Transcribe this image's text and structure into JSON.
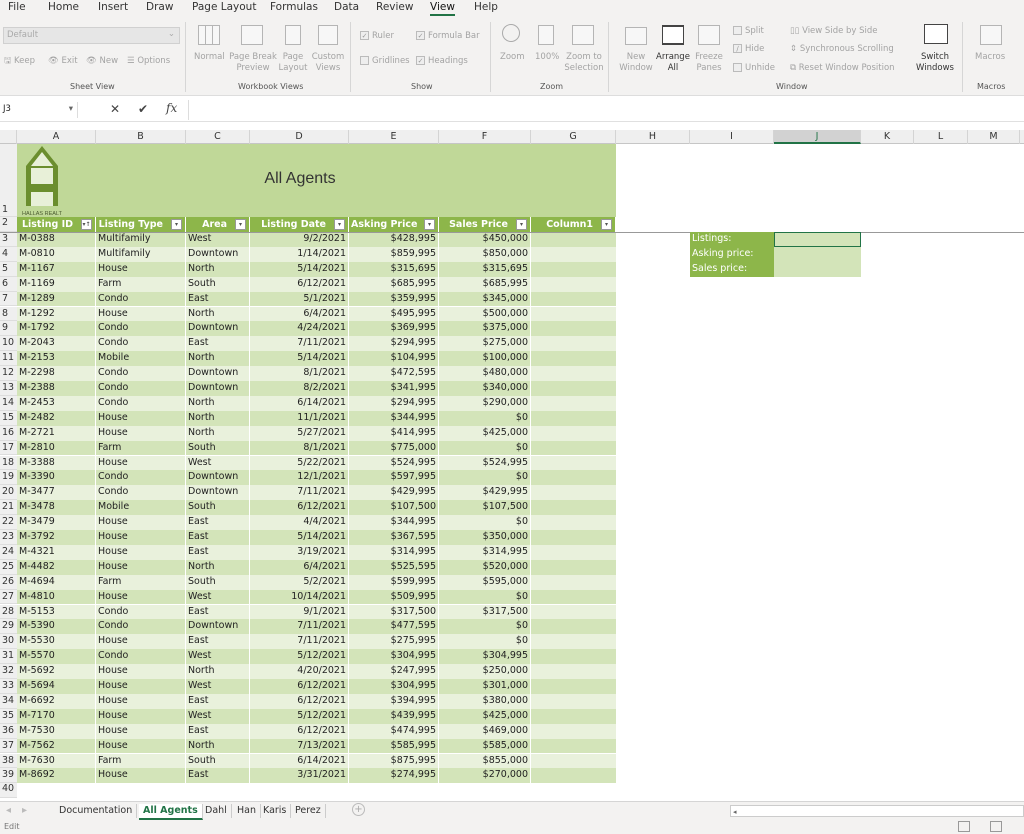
{
  "menu": [
    "File",
    "Home",
    "Insert",
    "Draw",
    "Page Layout",
    "Formulas",
    "Data",
    "Review",
    "View",
    "Help"
  ],
  "ribbon": {
    "sheet_view": {
      "dropdown": "Default",
      "keep": "Keep",
      "exit": "Exit",
      "new": "New",
      "options": "Options",
      "label": "Sheet View"
    },
    "workbook_views": {
      "normal": "Normal",
      "page_break": "Page Break Preview",
      "page_layout": "Page Layout",
      "custom": "Custom Views",
      "label": "Workbook Views"
    },
    "show": {
      "ruler": "Ruler",
      "formula_bar": "Formula Bar",
      "gridlines": "Gridlines",
      "headings": "Headings",
      "label": "Show",
      "ruler_checked": true,
      "formula_bar_checked": true,
      "gridlines_checked": false,
      "headings_checked": true
    },
    "zoom": {
      "zoom": "Zoom",
      "hundred": "100%",
      "zoom_sel": "Zoom to Selection",
      "label": "Zoom"
    },
    "window": {
      "new_window": "New Window",
      "arrange_all": "Arrange All",
      "freeze": "Freeze Panes",
      "split": "Split",
      "hide": "Hide",
      "unhide": "Unhide",
      "side_by_side": "View Side by Side",
      "sync": "Synchronous Scrolling",
      "reset": "Reset Window Position",
      "switch": "Switch Windows",
      "label": "Window"
    },
    "macros": {
      "macros": "Macros",
      "label": "Macros"
    }
  },
  "formula_bar": {
    "name_box": "J3",
    "value": ""
  },
  "columns": [
    "A",
    "B",
    "C",
    "D",
    "E",
    "F",
    "G",
    "H",
    "I",
    "J",
    "K",
    "L",
    "M"
  ],
  "sheet": {
    "title": "All Agents",
    "logo_text": "HALLAS REALTY",
    "headers": [
      "Listing ID",
      "Listing Type",
      "Area",
      "Listing Date",
      "Asking Price",
      "Sales Price",
      "Column1"
    ],
    "rows": [
      [
        "M-0388",
        "Multifamily",
        "West",
        "9/2/2021",
        "$428,995",
        "$450,000"
      ],
      [
        "M-0810",
        "Multifamily",
        "Downtown",
        "1/14/2021",
        "$859,995",
        "$850,000"
      ],
      [
        "M-1167",
        "House",
        "North",
        "5/14/2021",
        "$315,695",
        "$315,695"
      ],
      [
        "M-1169",
        "Farm",
        "South",
        "6/12/2021",
        "$685,995",
        "$685,995"
      ],
      [
        "M-1289",
        "Condo",
        "East",
        "5/1/2021",
        "$359,995",
        "$345,000"
      ],
      [
        "M-1292",
        "House",
        "North",
        "6/4/2021",
        "$495,995",
        "$500,000"
      ],
      [
        "M-1792",
        "Condo",
        "Downtown",
        "4/24/2021",
        "$369,995",
        "$375,000"
      ],
      [
        "M-2043",
        "Condo",
        "East",
        "7/11/2021",
        "$294,995",
        "$275,000"
      ],
      [
        "M-2153",
        "Mobile",
        "North",
        "5/14/2021",
        "$104,995",
        "$100,000"
      ],
      [
        "M-2298",
        "Condo",
        "Downtown",
        "8/1/2021",
        "$472,595",
        "$480,000"
      ],
      [
        "M-2388",
        "Condo",
        "Downtown",
        "8/2/2021",
        "$341,995",
        "$340,000"
      ],
      [
        "M-2453",
        "Condo",
        "North",
        "6/14/2021",
        "$294,995",
        "$290,000"
      ],
      [
        "M-2482",
        "House",
        "North",
        "11/1/2021",
        "$344,995",
        "$0"
      ],
      [
        "M-2721",
        "House",
        "North",
        "5/27/2021",
        "$414,995",
        "$425,000"
      ],
      [
        "M-2810",
        "Farm",
        "South",
        "8/1/2021",
        "$775,000",
        "$0"
      ],
      [
        "M-3388",
        "House",
        "West",
        "5/22/2021",
        "$524,995",
        "$524,995"
      ],
      [
        "M-3390",
        "Condo",
        "Downtown",
        "12/1/2021",
        "$597,995",
        "$0"
      ],
      [
        "M-3477",
        "Condo",
        "Downtown",
        "7/11/2021",
        "$429,995",
        "$429,995"
      ],
      [
        "M-3478",
        "Mobile",
        "South",
        "6/12/2021",
        "$107,500",
        "$107,500"
      ],
      [
        "M-3479",
        "House",
        "East",
        "4/4/2021",
        "$344,995",
        "$0"
      ],
      [
        "M-3792",
        "House",
        "East",
        "5/14/2021",
        "$367,595",
        "$350,000"
      ],
      [
        "M-4321",
        "House",
        "East",
        "3/19/2021",
        "$314,995",
        "$314,995"
      ],
      [
        "M-4482",
        "House",
        "North",
        "6/4/2021",
        "$525,595",
        "$520,000"
      ],
      [
        "M-4694",
        "Farm",
        "South",
        "5/2/2021",
        "$599,995",
        "$595,000"
      ],
      [
        "M-4810",
        "House",
        "West",
        "10/14/2021",
        "$509,995",
        "$0"
      ],
      [
        "M-5153",
        "Condo",
        "East",
        "9/1/2021",
        "$317,500",
        "$317,500"
      ],
      [
        "M-5390",
        "Condo",
        "Downtown",
        "7/11/2021",
        "$477,595",
        "$0"
      ],
      [
        "M-5530",
        "House",
        "East",
        "7/11/2021",
        "$275,995",
        "$0"
      ],
      [
        "M-5570",
        "Condo",
        "West",
        "5/12/2021",
        "$304,995",
        "$304,995"
      ],
      [
        "M-5692",
        "House",
        "North",
        "4/20/2021",
        "$247,995",
        "$250,000"
      ],
      [
        "M-5694",
        "House",
        "West",
        "6/12/2021",
        "$304,995",
        "$301,000"
      ],
      [
        "M-6692",
        "House",
        "East",
        "6/12/2021",
        "$394,995",
        "$380,000"
      ],
      [
        "M-7170",
        "House",
        "West",
        "5/12/2021",
        "$439,995",
        "$425,000"
      ],
      [
        "M-7530",
        "House",
        "East",
        "6/12/2021",
        "$474,995",
        "$469,000"
      ],
      [
        "M-7562",
        "House",
        "North",
        "7/13/2021",
        "$585,995",
        "$585,000"
      ],
      [
        "M-7630",
        "Farm",
        "South",
        "6/14/2021",
        "$875,995",
        "$855,000"
      ],
      [
        "M-8692",
        "House",
        "East",
        "3/31/2021",
        "$274,995",
        "$270,000"
      ]
    ],
    "summary": [
      "Listings:",
      "Asking price:",
      "Sales price:"
    ]
  },
  "tabs": [
    "Documentation",
    "All Agents",
    "Dahl",
    "Han",
    "Karis",
    "Perez"
  ],
  "active_tab": "All Agents",
  "status": {
    "mode": "Edit"
  },
  "colors": {
    "accent": "#217346",
    "header_green": "#8db64a",
    "band_dark": "#d3e4b9",
    "band_light": "#e9f1dc",
    "title_bg": "#c0d898"
  }
}
